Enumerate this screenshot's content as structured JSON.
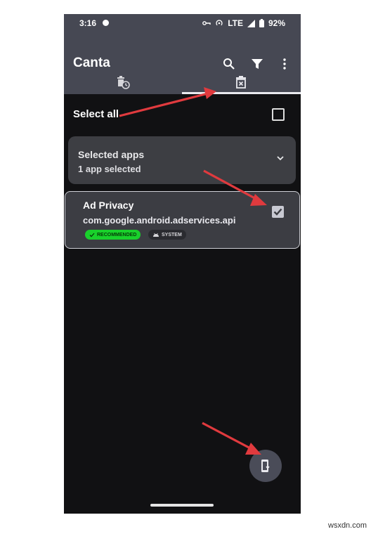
{
  "status_bar": {
    "time": "3:16",
    "network": "LTE",
    "battery": "92%"
  },
  "app_bar": {
    "title": "Canta",
    "icons": [
      "search-icon",
      "filter-icon",
      "more-vert-icon"
    ]
  },
  "tabs": [
    {
      "icon": "history-delete-icon",
      "selected": false
    },
    {
      "icon": "delete-icon",
      "selected": true
    }
  ],
  "select_all": {
    "label": "Select all",
    "checked": false
  },
  "selected_apps": {
    "title": "Selected apps",
    "subtitle": "1 app selected",
    "icon": "chevron-down-icon"
  },
  "app_item": {
    "name": "Ad Privacy",
    "package": "com.google.android.adservices.api",
    "badges": [
      "RECOMMENDED",
      "SYSTEM"
    ],
    "checked": true
  },
  "fab": {
    "icon": "phone-download-icon"
  },
  "watermark": "wsxdn.com",
  "colors": {
    "accent_arrow": "#e03a3e",
    "recommended_badge": "#19d12b",
    "app_bar": "#464853"
  }
}
